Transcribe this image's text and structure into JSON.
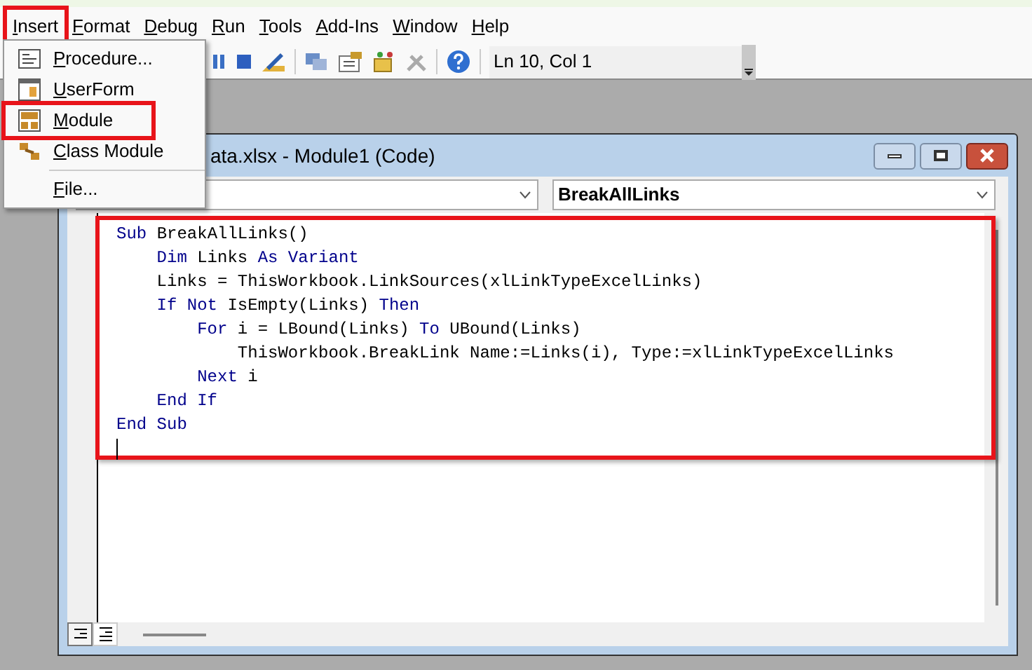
{
  "menu_bar": [
    {
      "label": "Insert",
      "highlighted": true
    },
    {
      "label": "Format",
      "highlighted": false
    },
    {
      "label": "Debug",
      "highlighted": false
    },
    {
      "label": "Run",
      "highlighted": false
    },
    {
      "label": "Tools",
      "highlighted": false
    },
    {
      "label": "Add-Ins",
      "highlighted": false
    },
    {
      "label": "Window",
      "highlighted": false
    },
    {
      "label": "Help",
      "highlighted": false
    }
  ],
  "toolbar": {
    "status": "Ln 10, Col 1"
  },
  "insert_menu": [
    {
      "kind": "procedure",
      "label": "Procedure...",
      "highlighted": false
    },
    {
      "kind": "userform",
      "label": "UserForm",
      "highlighted": false
    },
    {
      "kind": "module",
      "label": "Module",
      "highlighted": true
    },
    {
      "kind": "class",
      "label": "Class Module",
      "highlighted": false
    },
    {
      "kind": "file",
      "label": "File...",
      "highlighted": false
    }
  ],
  "code_window": {
    "title": "ata.xlsx - Module1 (Code)",
    "procedure": "BreakAllLinks",
    "highlighted": true,
    "lines": [
      [
        {
          "text": "Sub ",
          "kind": "keyword"
        },
        {
          "text": "BreakAllLinks()",
          "kind": "plain"
        }
      ],
      [
        {
          "text": "    Dim ",
          "kind": "keyword"
        },
        {
          "text": "Links ",
          "kind": "plain"
        },
        {
          "text": "As Variant",
          "kind": "keyword"
        }
      ],
      [
        {
          "text": "    Links = ThisWorkbook.LinkSources(xlLinkTypeExcelLinks)",
          "kind": "plain"
        }
      ],
      [
        {
          "text": "    If Not ",
          "kind": "keyword"
        },
        {
          "text": "IsEmpty(Links) ",
          "kind": "plain"
        },
        {
          "text": "Then",
          "kind": "keyword"
        }
      ],
      [
        {
          "text": "        For ",
          "kind": "keyword"
        },
        {
          "text": "i = LBound(Links) ",
          "kind": "plain"
        },
        {
          "text": "To ",
          "kind": "keyword"
        },
        {
          "text": "UBound(Links)",
          "kind": "plain"
        }
      ],
      [
        {
          "text": "            ThisWorkbook.BreakLink Name:=Links(i), Type:=xlLinkTypeExcelLinks",
          "kind": "plain"
        }
      ],
      [
        {
          "text": "        Next ",
          "kind": "keyword"
        },
        {
          "text": "i",
          "kind": "plain"
        }
      ],
      [
        {
          "text": "    End If",
          "kind": "keyword"
        }
      ],
      [
        {
          "text": "End Sub",
          "kind": "keyword"
        }
      ]
    ]
  }
}
